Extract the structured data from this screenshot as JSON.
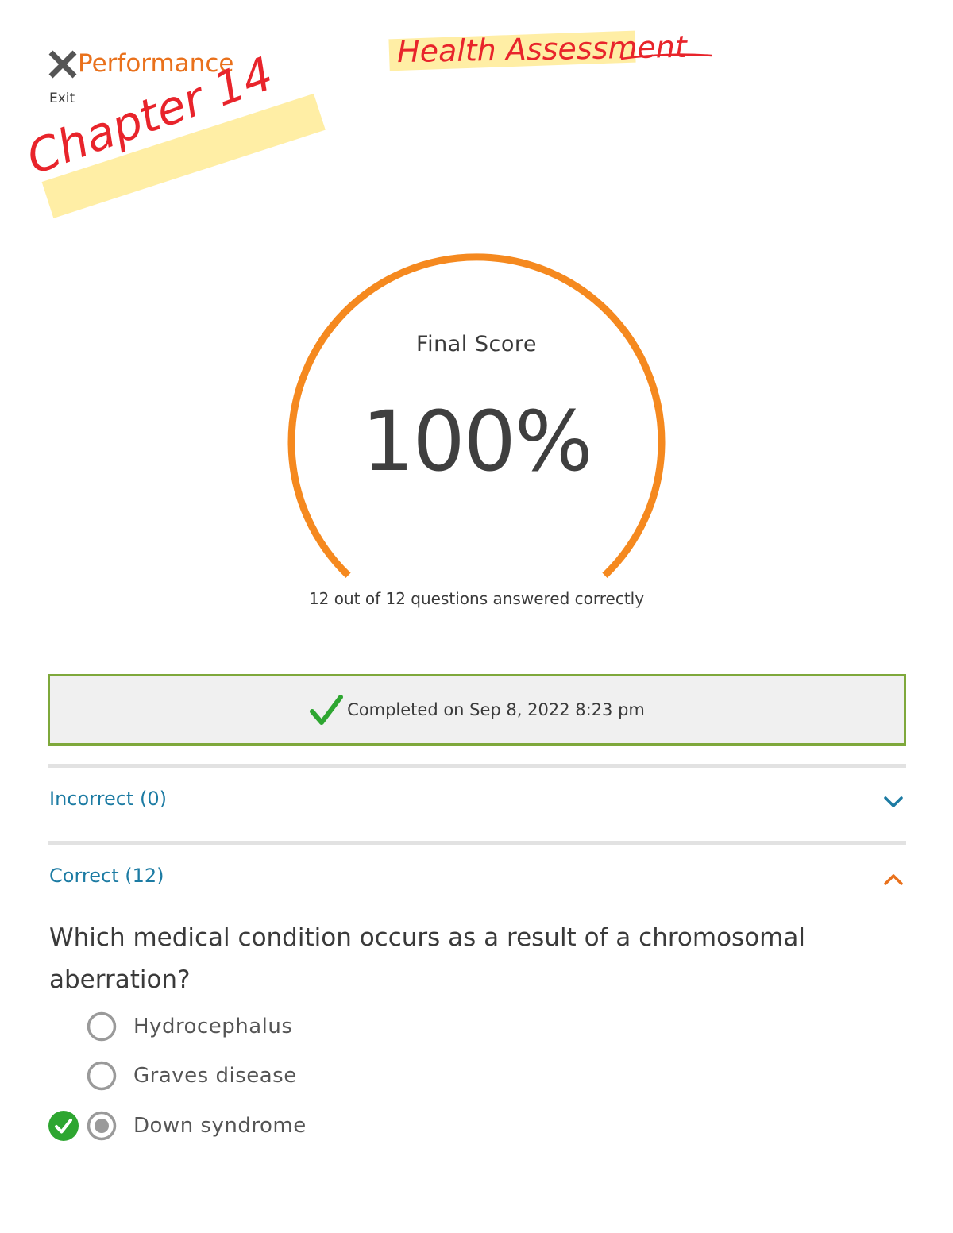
{
  "header": {
    "title": "Performance",
    "exit_label": "Exit"
  },
  "annotations": {
    "top_note": "Health Assessment",
    "side_note": "Chapter 14"
  },
  "score": {
    "title": "Final Score",
    "value": "100%",
    "fraction": 1.0,
    "caption": "12 out of 12 questions answered correctly"
  },
  "completion": {
    "text": "Completed on Sep 8, 2022 8:23 pm"
  },
  "sections": {
    "incorrect_label": "Incorrect (0)",
    "correct_label": "Correct (12)"
  },
  "question": {
    "text": "Which medical condition occurs as a result of a chromosomal aberration?",
    "options": [
      {
        "label": "Hydrocephalus",
        "selected": false
      },
      {
        "label": "Graves disease",
        "selected": false
      },
      {
        "label": "Down syndrome",
        "selected": true,
        "correct": true
      }
    ]
  },
  "colors": {
    "accent_orange": "#e9711c",
    "gauge_orange": "#f5891f",
    "link_blue": "#1c7ba3",
    "success_green": "#2ea631",
    "completed_border": "#7ea83b",
    "annotation_red": "#e8242b",
    "highlight_yellow": "#ffe882"
  }
}
